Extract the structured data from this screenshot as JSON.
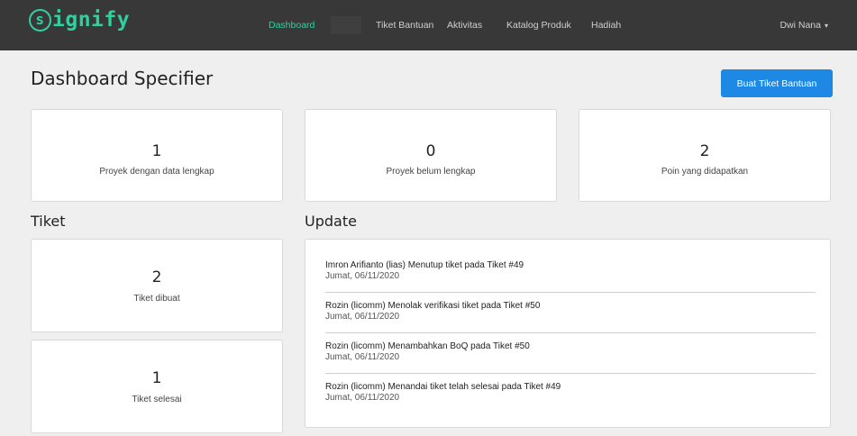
{
  "navbar": {
    "logo_mark": "s",
    "logo_text": "ignify",
    "links": [
      "Dashboard",
      "Tiket Bantuan",
      "Aktivitas",
      "Katalog Produk",
      "Hadiah"
    ],
    "user": "Dwi Nana",
    "caret": "▾",
    "accent_color": "#2fd0a0",
    "background_color": "#383838"
  },
  "header": {
    "title": "Dashboard Specifier",
    "create_ticket_label": "Buat Tiket Bantuan",
    "button_color": "#1e88e5"
  },
  "stats": [
    {
      "value": "1",
      "label": "Proyek dengan data lengkap"
    },
    {
      "value": "0",
      "label": "Proyek belum lengkap"
    },
    {
      "value": "2",
      "label": "Poin yang didapatkan"
    }
  ],
  "tiket": {
    "title": "Tiket",
    "cards": [
      {
        "value": "2",
        "label": "Tiket dibuat"
      },
      {
        "value": "1",
        "label": "Tiket selesai"
      }
    ]
  },
  "update": {
    "title": "Update",
    "items": [
      {
        "text": "Imron Arifianto (lias) Menutup tiket pada Tiket #49",
        "date": "Jumat, 06/11/2020"
      },
      {
        "text": "Rozin (licomm) Menolak verifikasi tiket pada Tiket #50",
        "date": "Jumat, 06/11/2020"
      },
      {
        "text": "Rozin (licomm) Menambahkan BoQ pada Tiket #50",
        "date": "Jumat, 06/11/2020"
      },
      {
        "text": "Rozin (licomm) Menandai tiket telah selesai pada Tiket #49",
        "date": "Jumat, 06/11/2020"
      }
    ]
  }
}
